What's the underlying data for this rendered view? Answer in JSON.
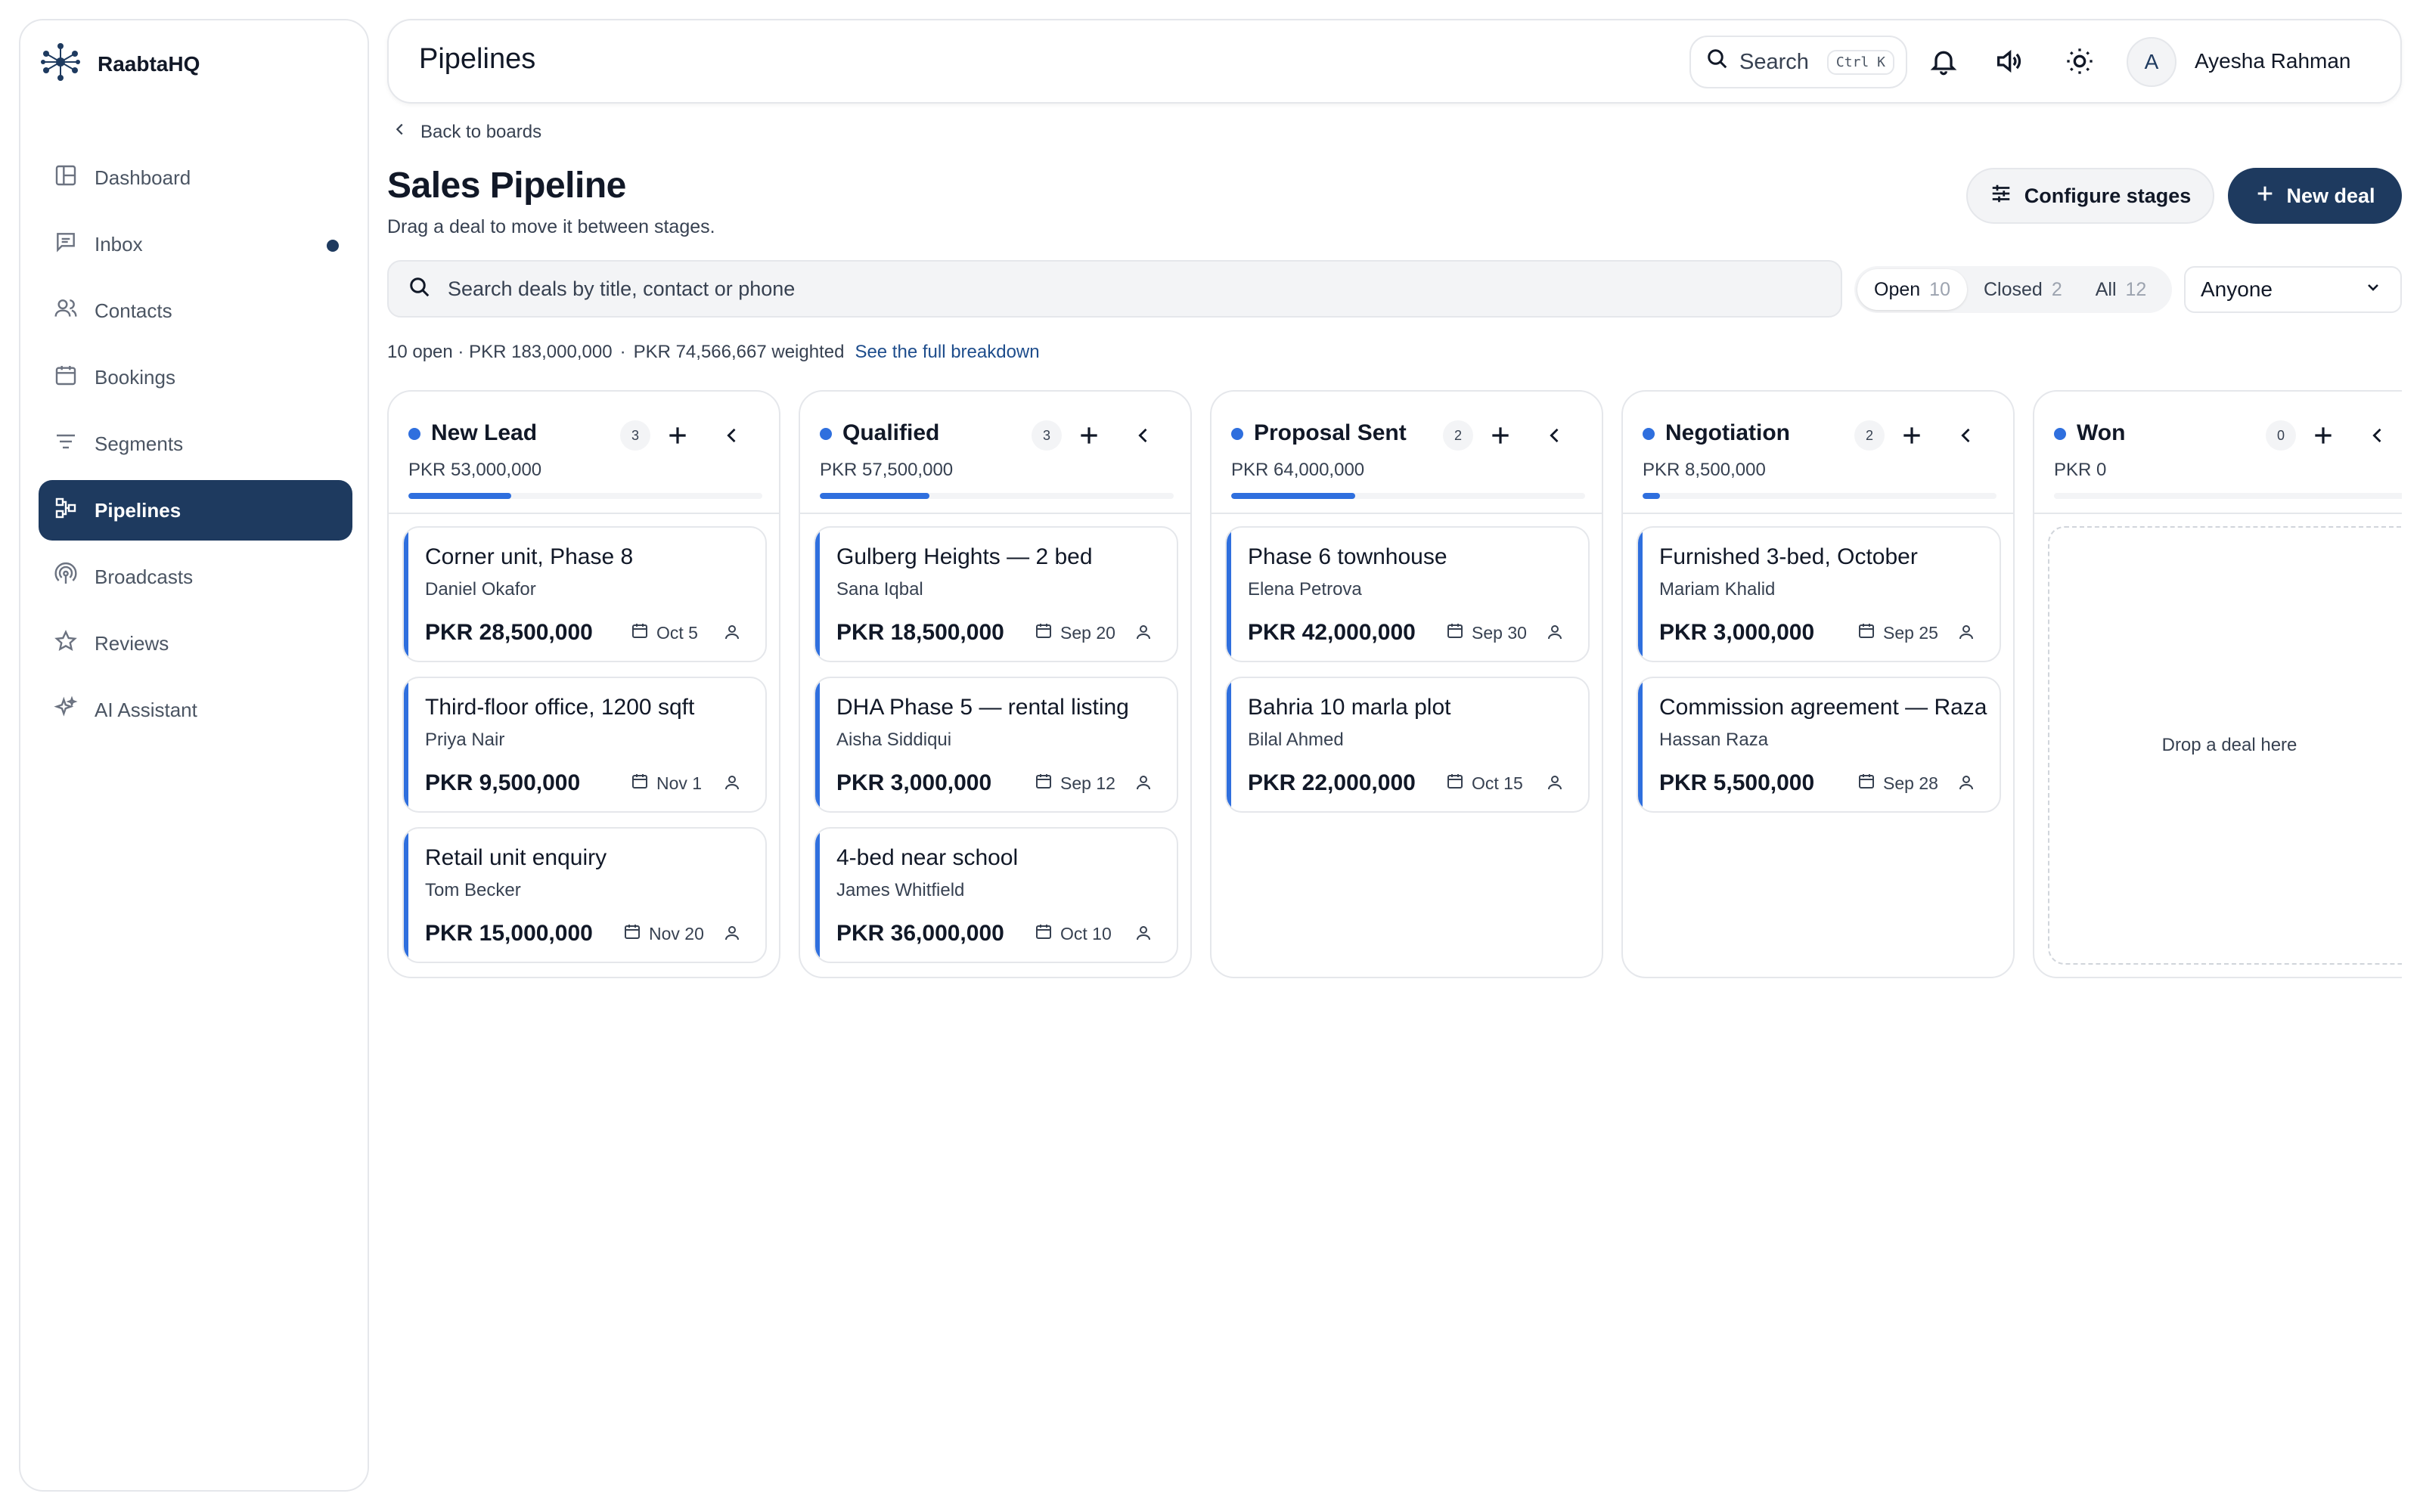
{
  "brand": {
    "name": "RaabtaHQ",
    "logo_icon": "network-logo-icon"
  },
  "sidebar": {
    "items": [
      {
        "label": "Dashboard",
        "icon": "dashboard-icon",
        "active": false
      },
      {
        "label": "Inbox",
        "icon": "inbox-icon",
        "active": false,
        "unread_dot": true
      },
      {
        "label": "Contacts",
        "icon": "contacts-icon",
        "active": false
      },
      {
        "label": "Bookings",
        "icon": "calendar-icon",
        "active": false
      },
      {
        "label": "Segments",
        "icon": "filter-icon",
        "active": false
      },
      {
        "label": "Pipelines",
        "icon": "pipeline-icon",
        "active": true
      },
      {
        "label": "Broadcasts",
        "icon": "broadcast-icon",
        "active": false
      },
      {
        "label": "Reviews",
        "icon": "star-icon",
        "active": false
      },
      {
        "label": "AI Assistant",
        "icon": "sparkle-icon",
        "active": false
      }
    ]
  },
  "topbar": {
    "title": "Pipelines",
    "search_label": "Search",
    "search_shortcut": "Ctrl K",
    "user_initial": "A",
    "user_name": "Ayesha Rahman"
  },
  "page": {
    "back_label": "Back to boards",
    "title": "Sales Pipeline",
    "subtitle": "Drag a deal to move it between stages.",
    "configure_label": "Configure stages",
    "new_deal_label": "New deal"
  },
  "filters": {
    "search_placeholder": "Search deals by title, contact or phone",
    "segments": [
      {
        "label": "Open",
        "count": "10",
        "active": true
      },
      {
        "label": "Closed",
        "count": "2",
        "active": false
      },
      {
        "label": "All",
        "count": "12",
        "active": false
      }
    ],
    "owner_value": "Anyone"
  },
  "summary": {
    "open": "10 open · PKR 183,000,000",
    "separator": "·",
    "weighted": "PKR 74,566,667 weighted",
    "breakdown_link": "See the full breakdown"
  },
  "accent_color": "#2f6fde",
  "brand_color": "#1e3a5f",
  "stages": [
    {
      "name": "New Lead",
      "count": "3",
      "total": "PKR 53,000,000",
      "progress": 0.29,
      "deals": [
        {
          "title": "Corner unit, Phase 8",
          "contact": "Daniel Okafor",
          "amount": "PKR 28,500,000",
          "date": "Oct 5"
        },
        {
          "title": "Third-floor office, 1200 sqft",
          "contact": "Priya Nair",
          "amount": "PKR 9,500,000",
          "date": "Nov 1"
        },
        {
          "title": "Retail unit enquiry",
          "contact": "Tom Becker",
          "amount": "PKR 15,000,000",
          "date": "Nov 20"
        }
      ]
    },
    {
      "name": "Qualified",
      "count": "3",
      "total": "PKR 57,500,000",
      "progress": 0.31,
      "deals": [
        {
          "title": "Gulberg Heights — 2 bed",
          "contact": "Sana Iqbal",
          "amount": "PKR 18,500,000",
          "date": "Sep 20"
        },
        {
          "title": "DHA Phase 5 — rental listing",
          "contact": "Aisha Siddiqui",
          "amount": "PKR 3,000,000",
          "date": "Sep 12"
        },
        {
          "title": "4-bed near school",
          "contact": "James Whitfield",
          "amount": "PKR 36,000,000",
          "date": "Oct 10"
        }
      ]
    },
    {
      "name": "Proposal Sent",
      "count": "2",
      "total": "PKR 64,000,000",
      "progress": 0.35,
      "deals": [
        {
          "title": "Phase 6 townhouse",
          "contact": "Elena Petrova",
          "amount": "PKR 42,000,000",
          "date": "Sep 30"
        },
        {
          "title": "Bahria 10 marla plot",
          "contact": "Bilal Ahmed",
          "amount": "PKR 22,000,000",
          "date": "Oct 15"
        }
      ]
    },
    {
      "name": "Negotiation",
      "count": "2",
      "total": "PKR 8,500,000",
      "progress": 0.05,
      "deals": [
        {
          "title": "Furnished 3-bed, October",
          "contact": "Mariam Khalid",
          "amount": "PKR 3,000,000",
          "date": "Sep 25"
        },
        {
          "title": "Commission agreement — Raza",
          "contact": "Hassan Raza",
          "amount": "PKR 5,500,000",
          "date": "Sep 28"
        }
      ]
    },
    {
      "name": "Won",
      "count": "0",
      "total": "PKR 0",
      "progress": 0,
      "deals": [],
      "empty_label": "Drop a deal here"
    }
  ]
}
